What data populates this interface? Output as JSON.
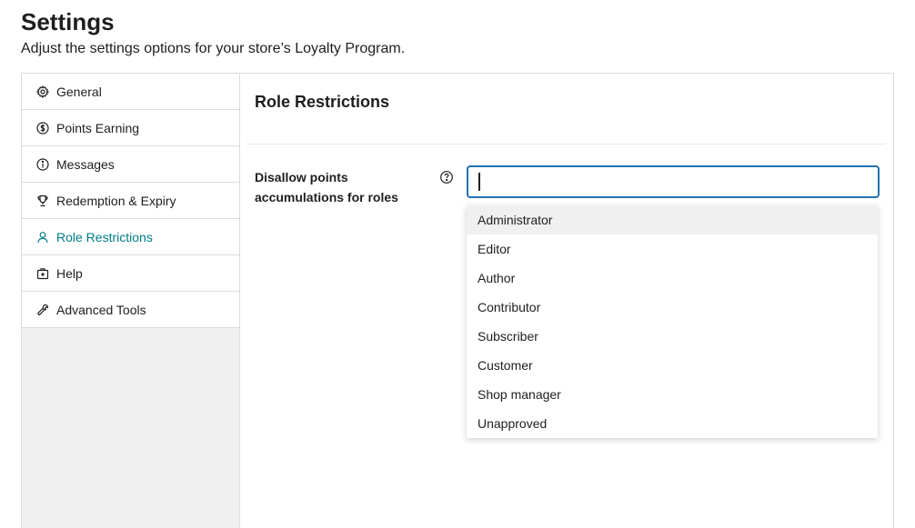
{
  "header": {
    "title": "Settings",
    "subtitle": "Adjust the settings options for your store’s Loyalty Program."
  },
  "sidebar": {
    "items": [
      {
        "label": "General",
        "icon": "gear-icon",
        "active": false
      },
      {
        "label": "Points Earning",
        "icon": "dollar-circle-icon",
        "active": false
      },
      {
        "label": "Messages",
        "icon": "info-circle-icon",
        "active": false
      },
      {
        "label": "Redemption & Expiry",
        "icon": "trophy-icon",
        "active": false
      },
      {
        "label": "Role Restrictions",
        "icon": "user-icon",
        "active": true
      },
      {
        "label": "Help",
        "icon": "first-aid-kit-icon",
        "active": false
      },
      {
        "label": "Advanced Tools",
        "icon": "wrench-icon",
        "active": false
      }
    ]
  },
  "main": {
    "section_title": "Role Restrictions",
    "field": {
      "label": "Disallow points accumulations for roles",
      "value": "",
      "placeholder": ""
    },
    "dropdown": {
      "highlighted_index": 0,
      "options": [
        "Administrator",
        "Editor",
        "Author",
        "Contributor",
        "Subscriber",
        "Customer",
        "Shop manager",
        "Unapproved"
      ]
    }
  },
  "colors": {
    "accent": "#007c89",
    "focus": "#2271b1",
    "border": "#dcdcde",
    "sidebar_bg": "#f0f0f1"
  }
}
